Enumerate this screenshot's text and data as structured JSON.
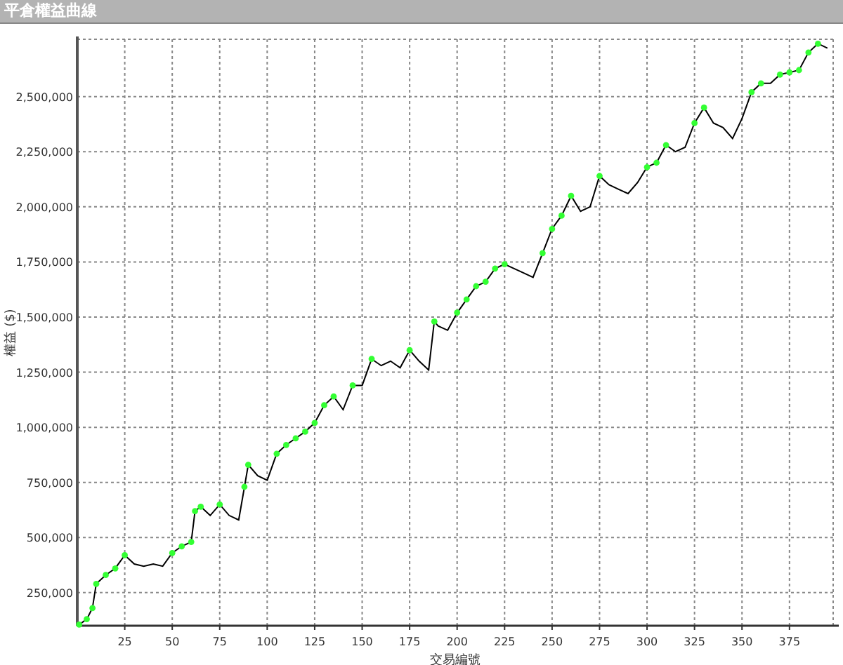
{
  "window": {
    "title": "平倉權益曲線"
  },
  "chart_data": {
    "type": "line",
    "grid": true,
    "xlabel": "交易編號",
    "ylabel": "權益 ($)",
    "xlim": [
      0,
      398
    ],
    "ylim": [
      100000,
      2760000
    ],
    "xticks": [
      25,
      50,
      75,
      100,
      125,
      150,
      175,
      200,
      225,
      250,
      275,
      300,
      325,
      350,
      375
    ],
    "yticks": [
      {
        "value": 250000,
        "label": "250,000"
      },
      {
        "value": 500000,
        "label": "500,000"
      },
      {
        "value": 750000,
        "label": "750,000"
      },
      {
        "value": 1000000,
        "label": "1,000,000"
      },
      {
        "value": 1250000,
        "label": "1,250,000"
      },
      {
        "value": 1500000,
        "label": "1,500,000"
      },
      {
        "value": 1750000,
        "label": "1,750,000"
      },
      {
        "value": 2000000,
        "label": "2,000,000"
      },
      {
        "value": 2250000,
        "label": "2,250,000"
      },
      {
        "value": 2500000,
        "label": "2,500,000"
      }
    ],
    "x": [
      1,
      5,
      8,
      10,
      15,
      20,
      25,
      30,
      35,
      40,
      45,
      50,
      55,
      60,
      62,
      65,
      70,
      75,
      80,
      85,
      88,
      90,
      95,
      100,
      105,
      110,
      115,
      120,
      125,
      130,
      135,
      140,
      145,
      150,
      155,
      160,
      165,
      170,
      175,
      180,
      185,
      188,
      190,
      195,
      200,
      205,
      210,
      215,
      220,
      225,
      230,
      235,
      240,
      245,
      250,
      255,
      260,
      265,
      270,
      275,
      280,
      285,
      290,
      295,
      300,
      305,
      310,
      315,
      320,
      325,
      330,
      335,
      340,
      345,
      350,
      355,
      360,
      365,
      370,
      375,
      380,
      385,
      390,
      395
    ],
    "series": [
      {
        "color": "#000000",
        "values": [
          105000,
          130000,
          180000,
          290000,
          330000,
          360000,
          420000,
          380000,
          370000,
          380000,
          370000,
          430000,
          460000,
          480000,
          620000,
          640000,
          600000,
          650000,
          600000,
          580000,
          730000,
          830000,
          780000,
          760000,
          880000,
          920000,
          950000,
          980000,
          1020000,
          1100000,
          1140000,
          1080000,
          1190000,
          1190000,
          1310000,
          1280000,
          1300000,
          1270000,
          1350000,
          1300000,
          1260000,
          1480000,
          1460000,
          1440000,
          1520000,
          1580000,
          1640000,
          1660000,
          1720000,
          1740000,
          1720000,
          1700000,
          1680000,
          1790000,
          1900000,
          1960000,
          2050000,
          1980000,
          2000000,
          2140000,
          2100000,
          2080000,
          2060000,
          2110000,
          2180000,
          2200000,
          2280000,
          2250000,
          2270000,
          2380000,
          2450000,
          2380000,
          2360000,
          2310000,
          2400000,
          2520000,
          2560000,
          2560000,
          2600000,
          2610000,
          2620000,
          2700000,
          2740000,
          2720000
        ]
      }
    ]
  }
}
